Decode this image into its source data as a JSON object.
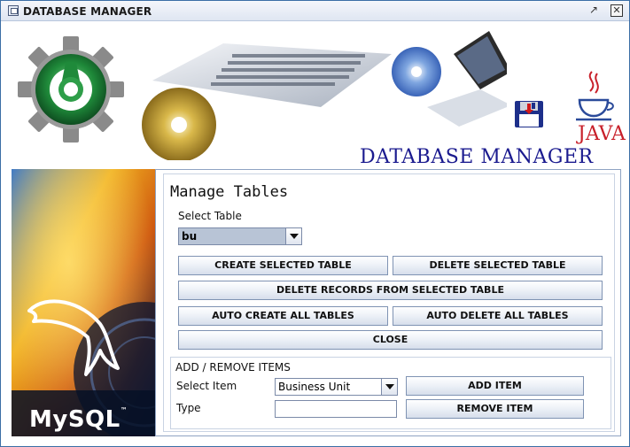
{
  "window": {
    "title": "DATABASE MANAGER"
  },
  "banner": {
    "title": "DATABASE MANAGER",
    "java_text": "JAVA",
    "mysql_text": "MySQL",
    "mysql_tm": "™"
  },
  "manage": {
    "heading": "Manage Tables",
    "select_table_label": "Select Table",
    "select_table_value": "bu",
    "buttons": {
      "create_selected": "CREATE SELECTED TABLE",
      "delete_selected": "DELETE SELECTED TABLE",
      "delete_records": "DELETE RECORDS FROM SELECTED TABLE",
      "auto_create": "AUTO CREATE ALL TABLES",
      "auto_delete": "AUTO DELETE ALL TABLES",
      "close": "CLOSE"
    }
  },
  "items": {
    "group_title": "ADD / REMOVE ITEMS",
    "select_item_label": "Select Item",
    "select_item_value": "Business Unit",
    "type_label": "Type",
    "type_value": "",
    "add_button": "ADD ITEM",
    "remove_button": "REMOVE ITEM"
  },
  "colors": {
    "accent": "#3b6ea5",
    "banner_title": "#1b1b8f",
    "java_red": "#c8202a",
    "combo_selected_bg": "#b8c4d6"
  },
  "icons": [
    "app-window-icon",
    "restore-icon",
    "close-icon",
    "gear-logo-icon",
    "floppy-disk-icon",
    "java-cup-icon",
    "dolphin-icon",
    "chevron-down-icon"
  ]
}
